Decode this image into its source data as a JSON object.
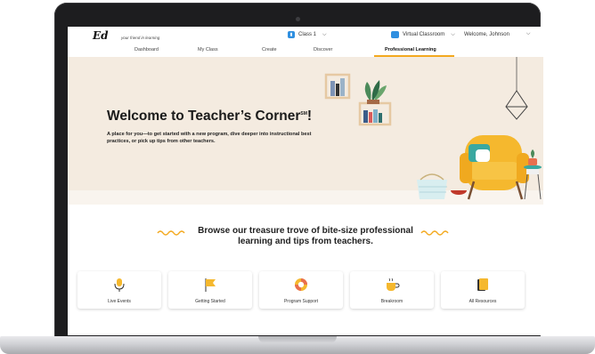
{
  "topbar": {
    "logo": "Ed",
    "logo_tagline": "your friend in learning",
    "class_label": "Class 1",
    "virtual_classroom_label": "Virtual Classroom",
    "welcome_label": "Welcome, Johnson"
  },
  "nav": {
    "items": [
      {
        "label": "Dashboard",
        "active": false
      },
      {
        "label": "My Class",
        "active": false
      },
      {
        "label": "Create",
        "active": false
      },
      {
        "label": "Discover",
        "active": false
      },
      {
        "label": "Professional Learning",
        "active": true
      }
    ]
  },
  "hero": {
    "title": "Welcome to Teacher’s Corner",
    "title_mark": "SM",
    "title_punct": "!",
    "subtitle": "A place for you—to get started with a new program, dive deeper into instructional best practices, or pick up tips from other teachers."
  },
  "browse": {
    "title": "Browse our treasure trove of bite-size professional learning and tips from teachers."
  },
  "cards": [
    {
      "label": "Live Events",
      "icon": "microphone-icon"
    },
    {
      "label": "Getting Started",
      "icon": "flag-icon"
    },
    {
      "label": "Program Support",
      "icon": "lifebuoy-icon"
    },
    {
      "label": "Breakroom",
      "icon": "coffee-cup-icon"
    },
    {
      "label": "All Resources",
      "icon": "books-icon"
    }
  ],
  "colors": {
    "accent": "#f3a91f",
    "hero_bg": "#f4ebe0",
    "brand_blue": "#2f8fe0",
    "chair_yellow": "#f5b82e"
  }
}
